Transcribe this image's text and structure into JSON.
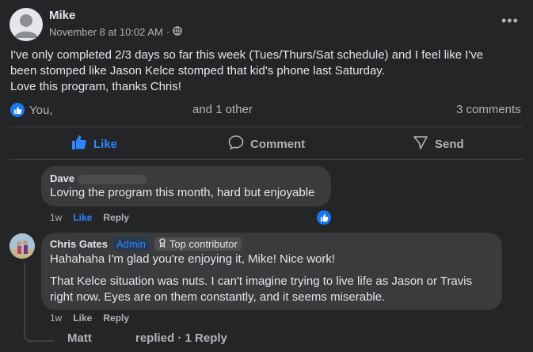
{
  "post": {
    "author": "Mike",
    "timestamp": "November 8 at 10:02 AM",
    "separator": "·",
    "more_label": "•••",
    "text_lines": [
      "I've only completed 2/3 days so far this week (Tues/Thurs/Sat schedule) and I feel like I've",
      "been stomped like Jason Kelce stomped that kid's phone last Saturday.",
      "Love this program, thanks Chris!"
    ],
    "reactions_text": "You,",
    "and_other": "and 1 other",
    "comments_count": "3 comments"
  },
  "actions": {
    "like": "Like",
    "comment": "Comment",
    "send": "Send"
  },
  "comments": [
    {
      "author": "Dave",
      "text": "Loving the program this month, hard but enjoyable",
      "time": "1w",
      "like": "Like",
      "reply": "Reply"
    },
    {
      "author": "Chris Gates",
      "admin_badge": "Admin",
      "top_badge": "Top contributor",
      "text_lines": [
        "Hahahaha I'm glad you're enjoying it, Mike! Nice work!",
        "That Kelce situation was nuts. I can't imagine trying to live life as Jason or Travis",
        "right now. Eyes are on them constantly, and it seems miserable."
      ],
      "time": "1w",
      "like": "Like",
      "reply": "Reply"
    }
  ],
  "replies_summary": {
    "name": "Matt",
    "text": "replied · 1 Reply"
  },
  "colors": {
    "background": "#242526",
    "bubble": "#3a3b3c",
    "accent": "#2d88ff",
    "muted": "#b0b3b8"
  }
}
